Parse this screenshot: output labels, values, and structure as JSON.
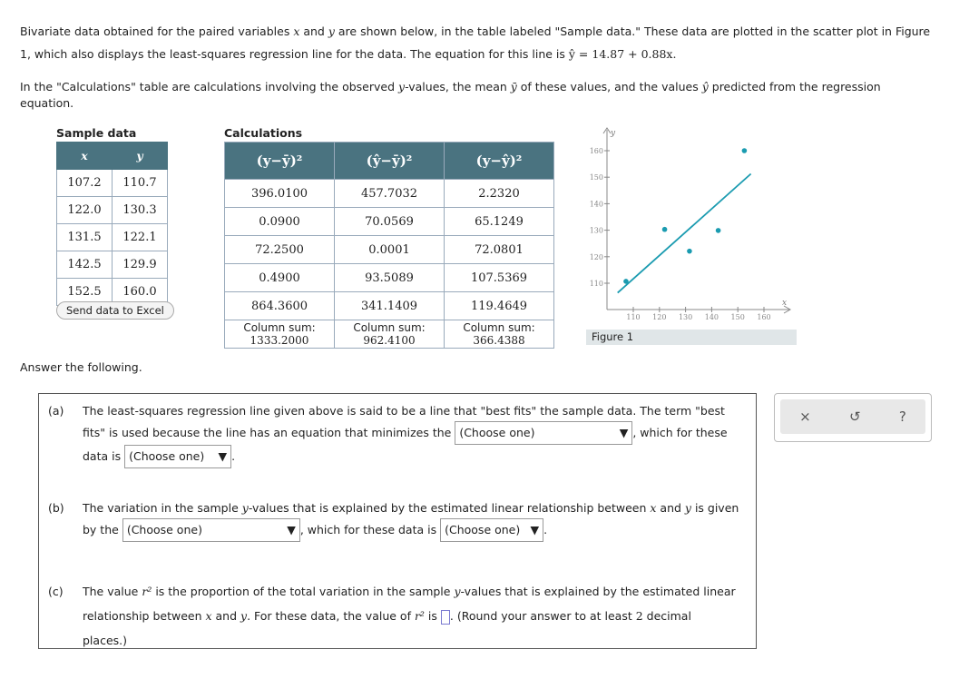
{
  "intro": {
    "p1a": "Bivariate data obtained for the paired variables ",
    "x": "x",
    "and": " and ",
    "y": "y",
    "p1b": " are shown below, in the table labeled \"Sample data.\" These data are plotted in the scatter plot in Figure",
    "p1c": "1, which also displays the least-squares regression line for the data. The equation for this line is ",
    "equation": "ŷ = 14.87 + 0.88x.",
    "p2a": "In the \"Calculations\" table are calculations involving the observed ",
    "p2b": "-values, the mean ",
    "ybar": "ȳ",
    "p2c": " of these values, and the values ",
    "yhat": "ŷ",
    "p2d": " predicted from the regression",
    "p2e": "equation."
  },
  "sample": {
    "title": "Sample data",
    "headers": [
      "x",
      "y"
    ],
    "rows": [
      [
        "107.2",
        "110.7"
      ],
      [
        "122.0",
        "130.3"
      ],
      [
        "131.5",
        "122.1"
      ],
      [
        "142.5",
        "129.9"
      ],
      [
        "152.5",
        "160.0"
      ]
    ],
    "button": "Send data to Excel"
  },
  "calc": {
    "title": "Calculations",
    "headers": [
      "(y−ȳ)²",
      "(ŷ−ȳ)²",
      "(y−ŷ)²"
    ],
    "rows": [
      [
        "396.0100",
        "457.7032",
        "2.2320"
      ],
      [
        "0.0900",
        "70.0569",
        "65.1249"
      ],
      [
        "72.2500",
        "0.0001",
        "72.0801"
      ],
      [
        "0.4900",
        "93.5089",
        "107.5369"
      ],
      [
        "864.3600",
        "341.1409",
        "119.4649"
      ]
    ],
    "sum_label": "Column sum:",
    "sums": [
      "1333.2000",
      "962.4100",
      "366.4388"
    ]
  },
  "chart_data": {
    "type": "scatter",
    "xlabel": "x",
    "ylabel": "y",
    "x_ticks": [
      110,
      120,
      130,
      140,
      150,
      160
    ],
    "y_ticks": [
      110,
      120,
      130,
      140,
      150,
      160
    ],
    "xlim": [
      101,
      167
    ],
    "ylim": [
      101,
      168
    ],
    "points": [
      [
        107.2,
        110.7
      ],
      [
        122.0,
        130.3
      ],
      [
        131.5,
        122.1
      ],
      [
        142.5,
        129.9
      ],
      [
        152.5,
        160.0
      ]
    ],
    "regression": {
      "intercept": 14.87,
      "slope": 0.88,
      "x_range": [
        104,
        155
      ]
    },
    "caption": "Figure 1",
    "color": "#1a9bb0"
  },
  "answer_prompt": "Answer the following.",
  "choose": "(Choose one)",
  "qa": {
    "label": "(a)",
    "t1": "The least-squares regression line given above is said to be a line that \"best fits\" the sample data. The term \"best",
    "t2": "fits\" is used because the line has an equation that minimizes the",
    "t3": ", which for these",
    "t4": "data is"
  },
  "qb": {
    "label": "(b)",
    "t1a": "The variation in the sample ",
    "t1b": "-values that is explained by the estimated linear relationship between ",
    "t1c": " and ",
    "t1d": " is given",
    "t2": "by the",
    "t3": ", which for these data is"
  },
  "qc": {
    "label": "(c)",
    "t1a": "The value ",
    "r2": "r²",
    "t1b": " is the proportion of the total variation in the sample ",
    "t1c": "-values that is explained by the estimated linear",
    "t2a": "relationship between ",
    "t2b": " and ",
    "t2c": ". For these data, the value of ",
    "t2d": " is ",
    "t2e": ". (Round your answer to at least ",
    "two": "2",
    "t2f": " decimal",
    "t3": "places.)"
  },
  "tools": {
    "close": "×",
    "undo": "↺",
    "help": "?"
  }
}
